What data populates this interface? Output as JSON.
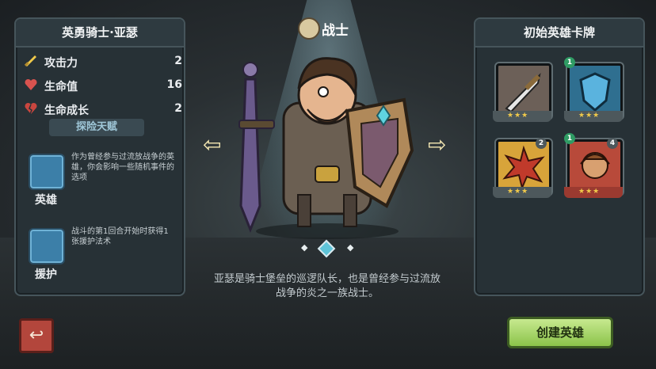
{
  "hero_panel": {
    "name": "英勇骑士·亚瑟",
    "stats": [
      {
        "label": "攻击力",
        "value": "2",
        "icon": "sword-icon"
      },
      {
        "label": "生命值",
        "value": "16",
        "icon": "heart-icon"
      },
      {
        "label": "生命成长",
        "value": "2",
        "icon": "broken-heart-icon"
      }
    ],
    "talents_header": "探险天赋",
    "talents": [
      {
        "name": "英雄",
        "desc": "作为曾经参与过流放战争的英雄，你会影响一些随机事件的选项",
        "icon": "hero-talent-icon"
      },
      {
        "name": "援护",
        "desc": "战斗的第1回合开始时获得1张援护法术",
        "icon": "support-talent-icon"
      }
    ]
  },
  "class": {
    "label": "战士",
    "icon": "warrior-class-icon"
  },
  "description": "亚瑟是骑士堡垒的巡逻队长，也是曾经参与过流放战争的炎之一族战士。",
  "cards_panel": {
    "title": "初始英雄卡牌",
    "cards": [
      {
        "icon": "sword-card-icon",
        "cost": "",
        "badge": "",
        "stars": "★★★"
      },
      {
        "icon": "shield-card-icon",
        "cost": "1",
        "badge": "",
        "stars": "★★★"
      },
      {
        "icon": "burst-card-icon",
        "cost": "",
        "badge": "2",
        "stars": "★★★"
      },
      {
        "icon": "ally-card-icon",
        "cost": "1",
        "badge": "4",
        "stars": "★★★"
      }
    ]
  },
  "buttons": {
    "create": "创建英雄",
    "back_icon": "back-icon"
  },
  "colors": {
    "accent": "#8bc34a",
    "back": "#b3463c",
    "panel": "#273136"
  }
}
